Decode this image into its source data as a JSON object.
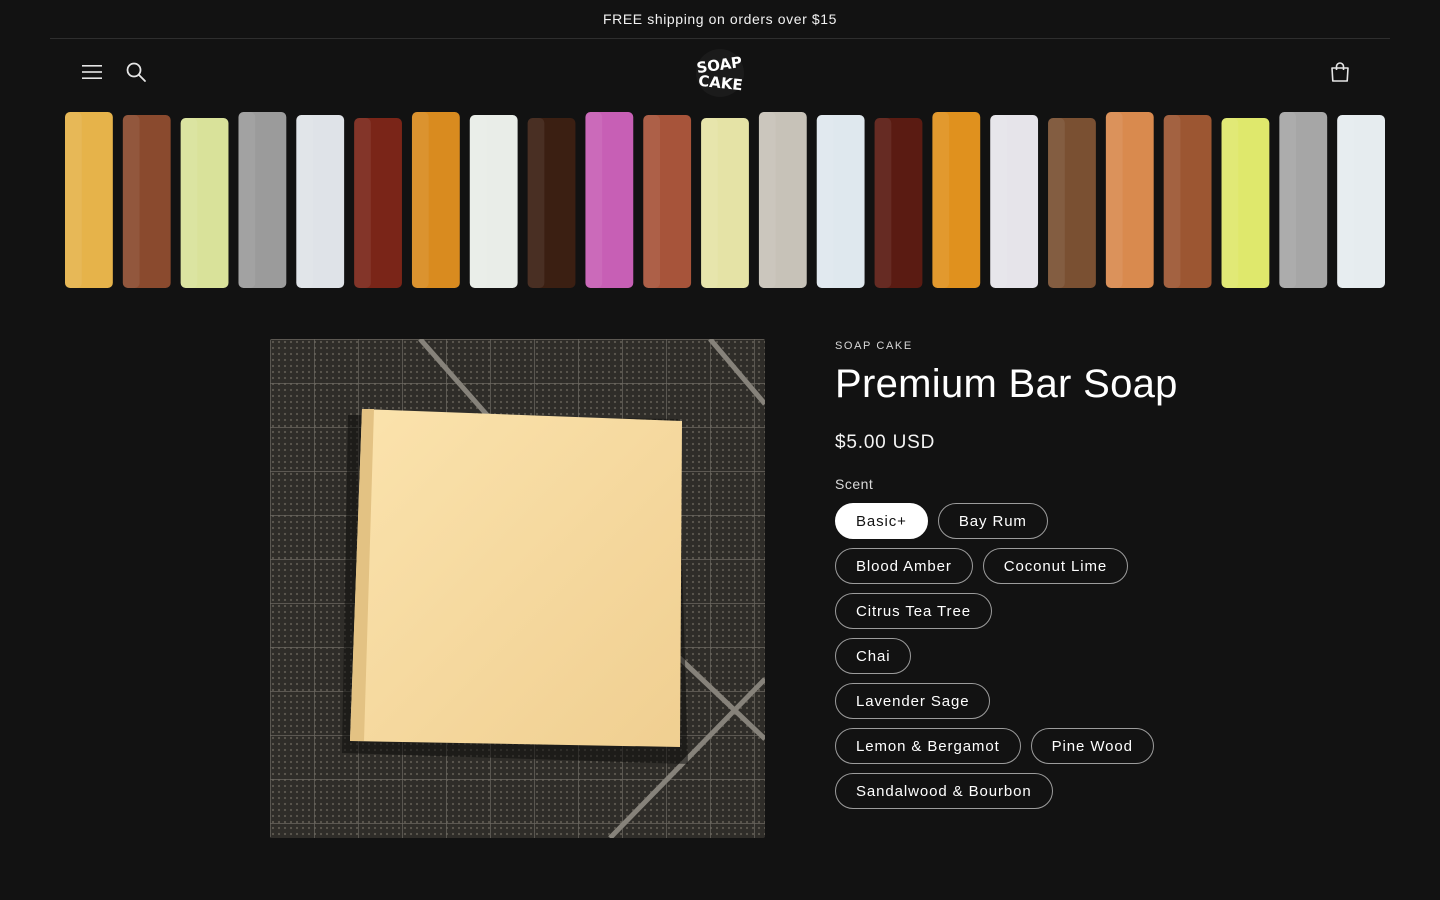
{
  "announcement": {
    "text": "FREE shipping on orders over $15"
  },
  "header": {
    "menu_icon": "hamburger-menu-icon",
    "search_icon": "search-icon",
    "cart_icon": "shopping-bag-icon",
    "logo_text": "SOAP CAKE"
  },
  "banner": {
    "bar_colors": [
      "#e6b34a",
      "#8a4a2e",
      "#d9e29a",
      "#9b9b9b",
      "#dfe3e8",
      "#7a2518",
      "#d98b1f",
      "#e9ede8",
      "#3b1f12",
      "#c75fb5",
      "#a7543a",
      "#e5e3a6",
      "#c7c2b8",
      "#dfe8ee",
      "#5a1b12",
      "#e0911e",
      "#e6e4ea",
      "#7a5032",
      "#d98a4e",
      "#9c5632",
      "#dfe86c",
      "#a6a6a6",
      "#e6ecef"
    ]
  },
  "product": {
    "vendor": "SOAP CAKE",
    "title": "Premium Bar Soap",
    "price": "$5.00 USD",
    "option_label": "Scent",
    "scents": [
      {
        "label": "Basic+",
        "selected": true
      },
      {
        "label": "Bay Rum",
        "selected": false
      },
      {
        "label": "Blood Amber",
        "selected": false
      },
      {
        "label": "Coconut Lime",
        "selected": false
      },
      {
        "label": "Citrus Tea Tree",
        "selected": false
      },
      {
        "label": "Chai",
        "selected": false
      },
      {
        "label": "Lavender Sage",
        "selected": false
      },
      {
        "label": "Lemon & Bergamot",
        "selected": false
      },
      {
        "label": "Pine Wood",
        "selected": false
      },
      {
        "label": "Sandalwood & Bourbon",
        "selected": false
      }
    ]
  },
  "colors": {
    "background": "#121212",
    "text": "#ffffff",
    "pill_border": "#9c9c9c",
    "soap": "#f6d9a0"
  }
}
